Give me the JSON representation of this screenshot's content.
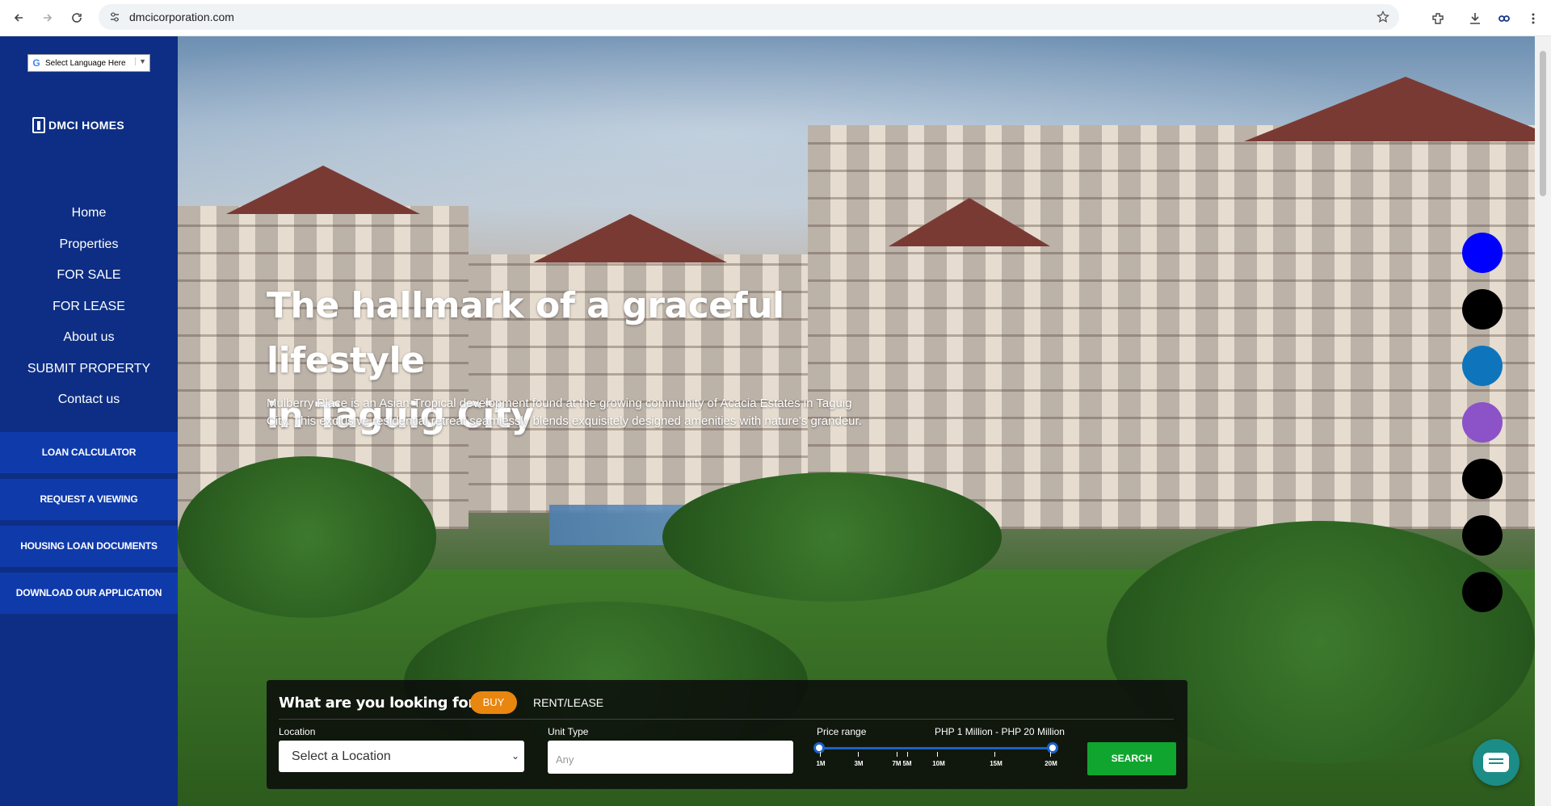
{
  "browser": {
    "url": "dmcicorporation.com",
    "icons": [
      "back-icon",
      "forward-icon",
      "reload-icon",
      "site-settings-icon",
      "bookmark-star-icon",
      "extensions-icon",
      "download-icon",
      "profile-icon",
      "menu-kebab-icon"
    ]
  },
  "sidebar": {
    "language_select": "Select Language Here",
    "logo_text": "DMCI HOMES",
    "menu": [
      "Home",
      "Properties",
      "FOR SALE",
      "FOR LEASE",
      "About us",
      "SUBMIT PROPERTY",
      "Contact us"
    ],
    "buttons": [
      "LOAN CALCULATOR",
      "REQUEST A VIEWING",
      "HOUSING LOAN DOCUMENTS",
      "DOWNLOAD OUR APPLICATION"
    ]
  },
  "hero": {
    "title_line1": "The hallmark of a graceful lifestyle",
    "title_line2": "in Taguig City",
    "description": "Mulberry Place is an Asian-Tropical development found at the growing community of Acacia Estates in Taguig City. This exclusive residential retreat seamlessly blends exquisitely designed amenities with nature's grandeur."
  },
  "swatches": [
    "#0000ff",
    "#000000",
    "#0e75bc",
    "#8c52c7",
    "#000000",
    "#000000",
    "#000000"
  ],
  "search": {
    "question": "What are you looking for?",
    "tab_buy": "BUY",
    "tab_rent": "RENT/LEASE",
    "location_label": "Location",
    "location_value": "Select a Location",
    "unit_type_label": "Unit Type",
    "unit_type_placeholder": "Any",
    "price_label": "Price range",
    "price_value": "PHP 1 Million - PHP 20 Million",
    "price_ticks": [
      "1M",
      "3M",
      "7M",
      "5M",
      "10M",
      "15M",
      "20M"
    ],
    "button": "SEARCH"
  },
  "colors": {
    "sidebar_bg": "#0d2e84",
    "sidebar_button_bg": "#0f3aaa",
    "buy_accent": "#e8860f",
    "search_button": "#10a52e",
    "chat_button": "#1c8c87"
  }
}
